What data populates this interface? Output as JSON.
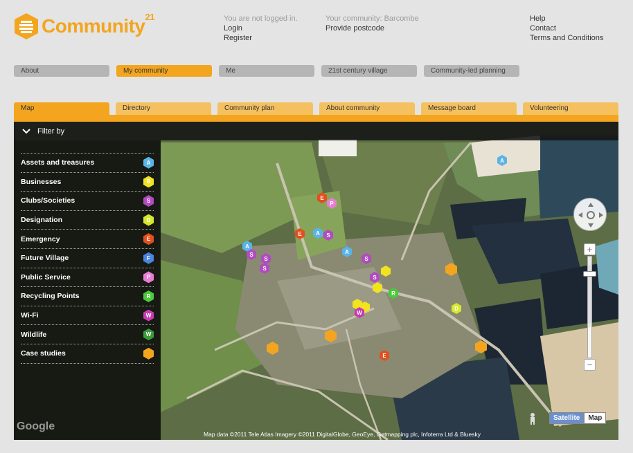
{
  "header": {
    "logo_text": "Community",
    "logo_sup": "21",
    "login_status": "You are not logged in.",
    "login": "Login",
    "register": "Register",
    "community_status": "Your community: Barcombe",
    "provide_postcode": "Provide postcode",
    "help": "Help",
    "contact": "Contact",
    "terms": "Terms and Conditions"
  },
  "topnav": [
    "About",
    "My community",
    "Me",
    "21st century village",
    "Community-led planning"
  ],
  "topnav_active": "My community",
  "tabs": [
    "Map",
    "Directory",
    "Community plan",
    "About community",
    "Message board",
    "Volunteering"
  ],
  "tabs_active": "Map",
  "filter": {
    "title": "Filter by",
    "items": [
      {
        "label": "Assets and treasures",
        "letter": "A",
        "color": "#5ab4e6"
      },
      {
        "label": "Businesses",
        "letter": "B",
        "color": "#f2e31f"
      },
      {
        "label": "Clubs/Societies",
        "letter": "S",
        "color": "#b04bc0"
      },
      {
        "label": "Designation",
        "letter": "D",
        "color": "#d6e82a"
      },
      {
        "label": "Emergency",
        "letter": "E",
        "color": "#e0501e"
      },
      {
        "label": "Future Village",
        "letter": "F",
        "color": "#4a86e0"
      },
      {
        "label": "Public Service",
        "letter": "P",
        "color": "#e77ed4"
      },
      {
        "label": "Recycling Points",
        "letter": "R",
        "color": "#4cc93c"
      },
      {
        "label": "Wi-Fi",
        "letter": "W",
        "color": "#c63cb0"
      },
      {
        "label": "Wildlife",
        "letter": "W",
        "color": "#3b9c3b"
      },
      {
        "label": "Case studies",
        "letter": "",
        "color": "#f3a51f"
      }
    ]
  },
  "map": {
    "google": "Google",
    "maptype_satellite": "Satellite",
    "maptype_map": "Map",
    "attribution": "Map data ©2011 Tele Atlas Imagery ©2011 DigitalGlobe, GeoEye, Getmapping plc, Infoterra Ltd & Bluesky"
  },
  "colors": {
    "accent": "#f3a51f",
    "accent_light": "#f5c160",
    "nav_grey": "#b5b5b5"
  }
}
